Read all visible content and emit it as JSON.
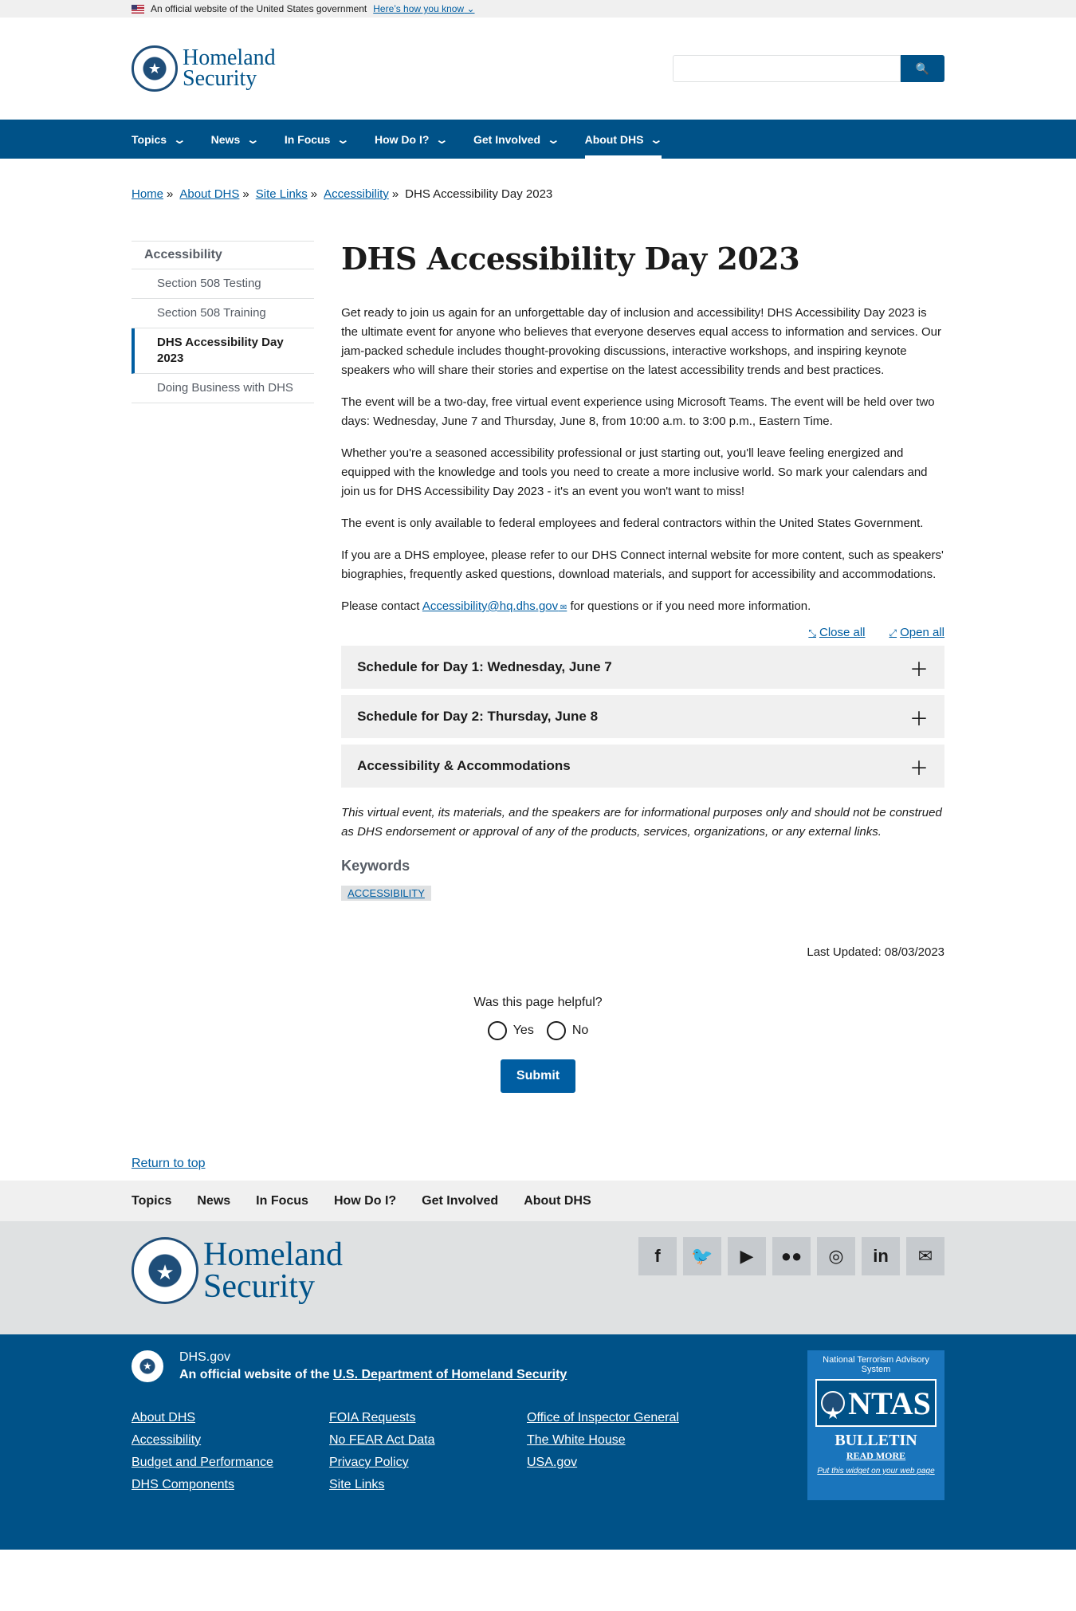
{
  "gov_banner": {
    "text": "An official website of the United States government",
    "link": "Here’s how you know"
  },
  "header": {
    "logo_line1": "Homeland",
    "logo_line2": "Security",
    "search_placeholder": ""
  },
  "nav": [
    {
      "label": "Topics"
    },
    {
      "label": "News"
    },
    {
      "label": "In Focus"
    },
    {
      "label": "How Do I?"
    },
    {
      "label": "Get Involved"
    },
    {
      "label": "About DHS"
    }
  ],
  "breadcrumb": [
    "Home",
    "About DHS",
    "Site Links",
    "Accessibility",
    "DHS Accessibility Day 2023"
  ],
  "breadcrumb_sep": "»",
  "sidenav": {
    "heading": "Accessibility",
    "items": [
      "Section 508 Testing",
      "Section 508 Training",
      "DHS Accessibility Day 2023",
      "Doing Business with DHS"
    ]
  },
  "main": {
    "title": "DHS Accessibility Day 2023",
    "paragraphs": [
      "Get ready to join us again for an unforgettable day of inclusion and accessibility! DHS Accessibility Day 2023 is the ultimate event for anyone who believes that everyone deserves equal access to information and services. Our jam-packed schedule includes thought-provoking discussions, interactive workshops, and inspiring keynote speakers who will share their stories and expertise on the latest accessibility trends and best practices.",
      "The event will be a two-day, free virtual event experience using Microsoft Teams. The event will be held over two days: Wednesday, June 7 and Thursday, June 8, from 10:00 a.m. to 3:00 p.m., Eastern Time.",
      "Whether you're a seasoned accessibility professional or just starting out, you'll leave feeling energized and equipped with the knowledge and tools you need to create a more inclusive world. So mark your calendars and join us for DHS Accessibility Day 2023 - it's an event you won't want to miss!",
      "The event is only available to federal employees and federal contractors within the United States Government.",
      "If you are a DHS employee, please refer to our DHS Connect internal website for more content, such as speakers' biographies, frequently asked questions, download materials, and support for accessibility and accommodations."
    ],
    "contact_pre": "Please contact",
    "contact_email": "Accessibility@hq.dhs.gov",
    "contact_post": "for questions or if you need more information.",
    "close_all": "Close all",
    "open_all": "Open all",
    "accordions": [
      "Schedule for Day 1: Wednesday, June 7",
      "Schedule for Day 2: Thursday, June 8",
      "Accessibility & Accommodations"
    ],
    "disclaimer": "This virtual event, its materials, and the speakers are for informational purposes only and should not be construed as DHS endorsement or approval of any of the products, services, organizations, or any external links.",
    "keywords_title": "Keywords",
    "keyword": "ACCESSIBILITY",
    "last_updated": "Last Updated: 08/03/2023"
  },
  "feedback": {
    "question": "Was this page helpful?",
    "yes": "Yes",
    "no": "No",
    "submit": "Submit"
  },
  "return_to_top": "Return to top",
  "footer_nav": [
    "Topics",
    "News",
    "In Focus",
    "How Do I?",
    "Get Involved",
    "About DHS"
  ],
  "footer_logo": {
    "line1": "Homeland",
    "line2": "Security"
  },
  "social": [
    {
      "icon": "facebook-icon",
      "glyph": "f"
    },
    {
      "icon": "twitter-icon",
      "glyph": "🐦"
    },
    {
      "icon": "youtube-icon",
      "glyph": "▶"
    },
    {
      "icon": "flickr-icon",
      "glyph": "●●"
    },
    {
      "icon": "instagram-icon",
      "glyph": "◎"
    },
    {
      "icon": "linkedin-icon",
      "glyph": "in"
    },
    {
      "icon": "email-icon",
      "glyph": "✉"
    }
  ],
  "identifier": {
    "domain": "DHS.gov",
    "official_pre": "An official website of the",
    "official_link": "U.S. Department of Homeland Security"
  },
  "footer_links": [
    [
      "About DHS",
      "Accessibility",
      "Budget and Performance",
      "DHS Components"
    ],
    [
      "FOIA Requests",
      "No FEAR Act Data",
      "Privacy Policy",
      "Site Links"
    ],
    [
      "Office of Inspector General",
      "The White House",
      "USA.gov"
    ]
  ],
  "ntas": {
    "title": "National Terrorism Advisory System",
    "logo": "NTAS",
    "bulletin": "BULLETIN",
    "read_more": "READ MORE",
    "widget": "Put this widget on your web page"
  },
  "colors": {
    "primary": "#005288",
    "link": "#005ea2",
    "gray_bg": "#f0f0f0"
  }
}
